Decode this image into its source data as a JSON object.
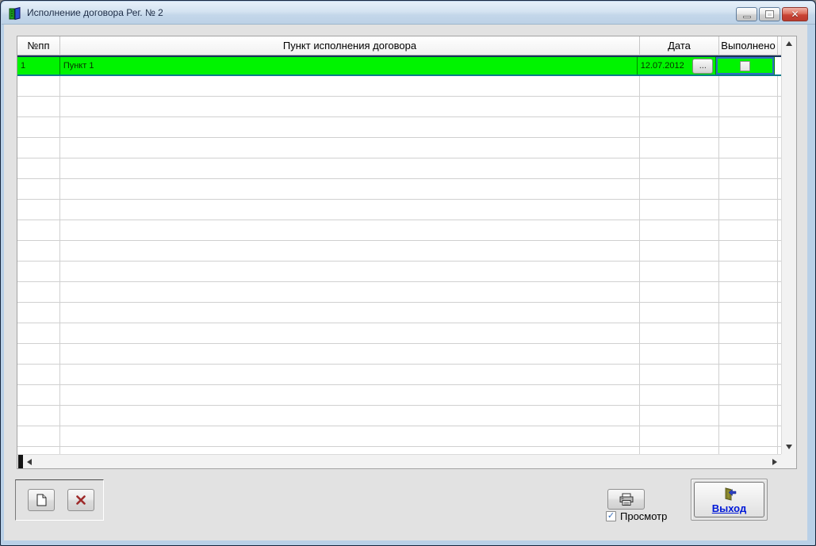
{
  "window": {
    "title": "Исполнение договора Рег. № 2",
    "icon": "books-icon",
    "close_glyph": "✕"
  },
  "grid": {
    "columns": [
      "№пп",
      "Пункт исполнения договора",
      "Дата",
      "Выполнено"
    ],
    "row": {
      "num": "1",
      "item": "Пункт 1",
      "date": "12.07.2012",
      "ellipsis_label": "...",
      "done_checked": false
    },
    "empty_row_count": 19
  },
  "toolbar": {
    "new_button_icon": "new-document-icon",
    "delete_button_icon": "delete-x-icon"
  },
  "print": {
    "button_icon": "printer-icon",
    "checkbox_label": "Просмотр",
    "checkbox_checked": true,
    "check_glyph": "✓"
  },
  "exit": {
    "label": "Выход",
    "icon": "exit-door-icon"
  },
  "colors": {
    "row_highlight": "#00F400",
    "focus_border": "#2F6FC1",
    "exit_link": "#0018D8",
    "close_button": "#C94435",
    "titlebar": "#C4D7EA"
  }
}
